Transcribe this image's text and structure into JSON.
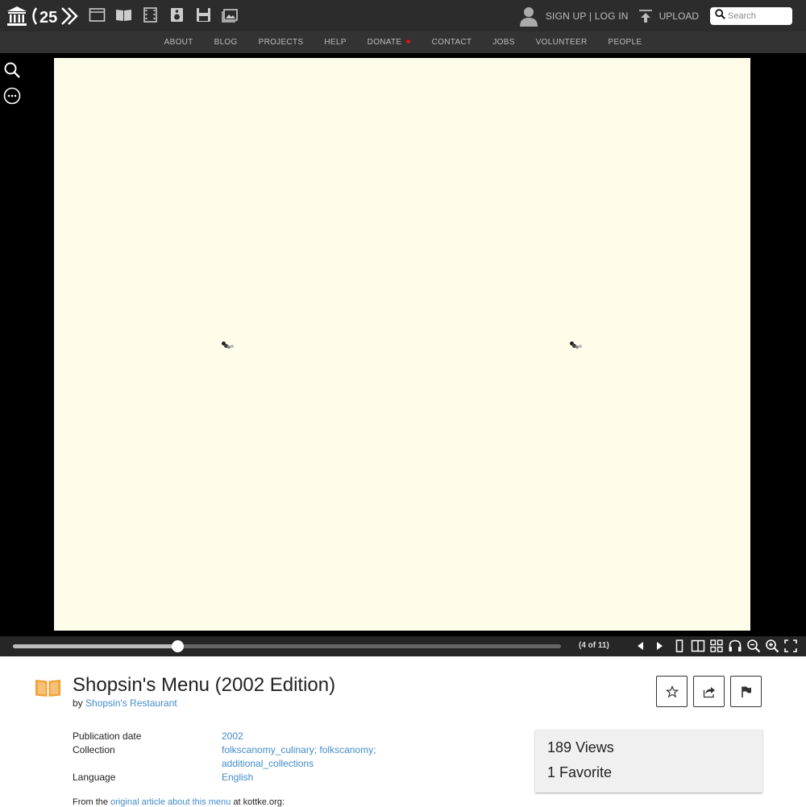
{
  "header": {
    "logo_text": "(25)",
    "media_icons": [
      "web-icon",
      "texts-icon",
      "video-icon",
      "audio-icon",
      "software-icon",
      "images-icon"
    ],
    "auth": "SIGN UP | LOG IN",
    "upload": "UPLOAD",
    "search_placeholder": "Search"
  },
  "nav": {
    "items": [
      "ABOUT",
      "BLOG",
      "PROJECTS",
      "HELP",
      "DONATE",
      "CONTACT",
      "JOBS",
      "VOLUNTEER",
      "PEOPLE"
    ]
  },
  "reader": {
    "page_indicator": "(4 of 11)",
    "progress_fraction": 0.3
  },
  "item": {
    "title": "Shopsin's Menu (2002 Edition)",
    "by": "by",
    "author": "Shopsin's Restaurant",
    "fields": {
      "pubdate_label": "Publication date",
      "pubdate_value": "2002",
      "collection_label": "Collection",
      "collection_1": "folkscanomy_culinary",
      "collection_2": "folkscanomy",
      "collection_3": "additional_collections",
      "language_label": "Language",
      "language_value": "English"
    },
    "views": "189",
    "views_label": "Views",
    "favorites": "1",
    "favorites_label": "Favorite",
    "desc_prefix": "From the",
    "desc_link": "original article about this menu",
    "desc_suffix": "at kottke.org:"
  },
  "colors": {
    "link": "#428bca",
    "page_bg": "#fffdea",
    "book_icon": "#f0a030",
    "heart": "#e11111"
  }
}
